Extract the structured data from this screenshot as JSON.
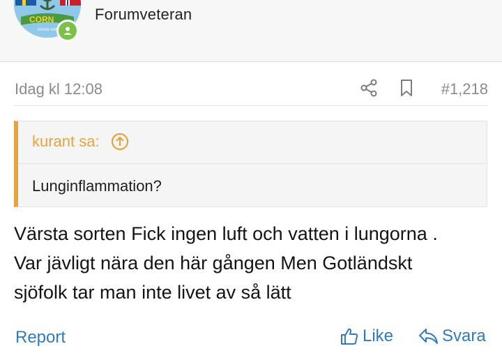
{
  "user": {
    "rank": "Forumveteran",
    "avatar_text": "CORN",
    "avatar_subtext": "KRUKE KAN"
  },
  "post": {
    "date": "Idag kl 12:08",
    "number": "#1,218"
  },
  "quote": {
    "author": "kurant sa:",
    "text": "Lunginflammation?"
  },
  "message": {
    "lines": [
      "Värsta sorten Fick ingen luft och vatten i lungorna .",
      "Var jävligt nära den här gången Men Gotländskt",
      "sjöfolk tar man inte livet av så lätt"
    ]
  },
  "actions": {
    "report": "Report",
    "like": "Like",
    "reply": "Svara"
  },
  "colors": {
    "accent": "#2f7bbf",
    "quote_border": "#e8a33d",
    "online": "#7cc14a"
  },
  "icons": [
    "share-icon",
    "bookmark-icon",
    "arrow-up-circle-icon",
    "thumbs-up-icon",
    "reply-arrow-icon",
    "online-user-icon"
  ]
}
